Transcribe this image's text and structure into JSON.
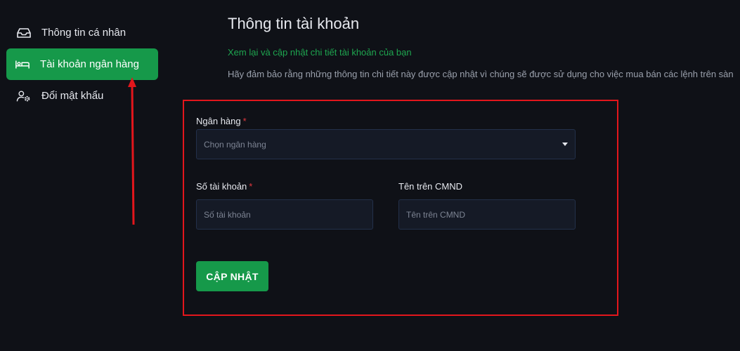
{
  "sidebar": {
    "items": [
      {
        "label": "Thông tin cá nhân",
        "icon": "inbox-icon"
      },
      {
        "label": "Tài khoản ngân hàng",
        "icon": "bed-icon",
        "active": true
      },
      {
        "label": "Đổi mật khẩu",
        "icon": "user-settings-icon"
      }
    ]
  },
  "header": {
    "title": "Thông tin tài khoản",
    "subtitle": "Xem lại và cập nhật chi tiết tài khoản của bạn",
    "description": "Hãy đảm bảo rằng những thông tin chi tiết này được cập nhật vì chúng sẽ được sử dụng cho việc mua bán các lệnh trên sàn"
  },
  "form": {
    "bank": {
      "label": "Ngân hàng",
      "required_mark": "*",
      "placeholder": "Chọn ngân hàng"
    },
    "account_number": {
      "label": "Số tài khoản",
      "required_mark": "*",
      "placeholder": "Số tài khoản"
    },
    "id_name": {
      "label": "Tên trên CMND",
      "placeholder": "Tên trên CMND"
    },
    "submit_label": "CẬP NHẬT"
  },
  "colors": {
    "accent": "#16994a",
    "subtitle": "#1ea54f",
    "background": "#0f1117",
    "annotation": "#e3161c"
  }
}
